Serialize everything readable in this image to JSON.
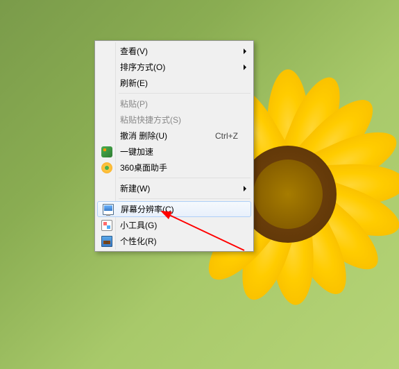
{
  "menu": {
    "items": [
      {
        "label": "查看(V)",
        "has_submenu": true
      },
      {
        "label": "排序方式(O)",
        "has_submenu": true
      },
      {
        "label": "刷新(E)"
      },
      {
        "separator": true
      },
      {
        "label": "粘贴(P)",
        "disabled": true
      },
      {
        "label": "粘贴快捷方式(S)",
        "disabled": true
      },
      {
        "label": "撤消 删除(U)",
        "shortcut": "Ctrl+Z"
      },
      {
        "label": "一键加速",
        "icon": "360accel"
      },
      {
        "label": "360桌面助手",
        "icon": "360desktop"
      },
      {
        "separator": true
      },
      {
        "label": "新建(W)",
        "has_submenu": true
      },
      {
        "separator": true
      },
      {
        "label": "屏幕分辨率(C)",
        "icon": "monitor",
        "highlighted": true
      },
      {
        "label": "小工具(G)",
        "icon": "gadget"
      },
      {
        "label": "个性化(R)",
        "icon": "personalize"
      }
    ]
  }
}
